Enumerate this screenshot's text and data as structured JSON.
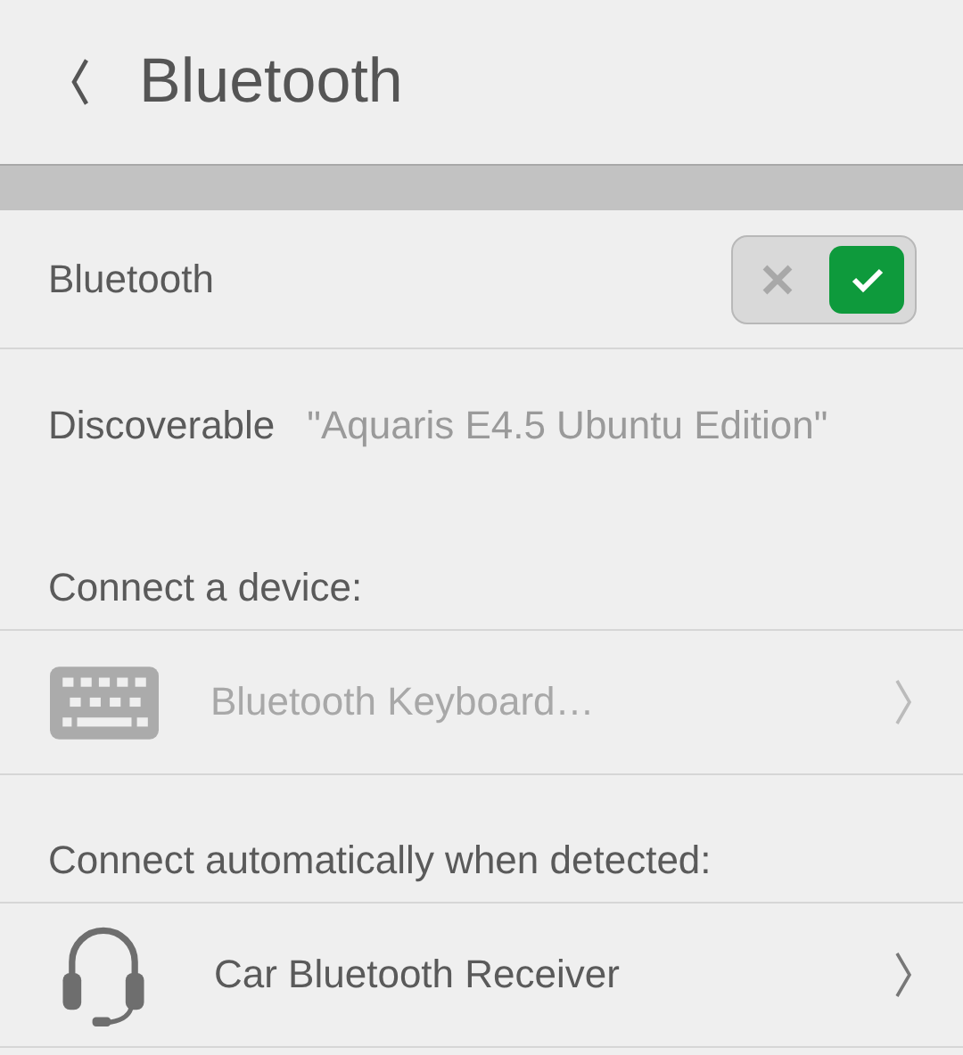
{
  "header": {
    "title": "Bluetooth"
  },
  "toggle_row": {
    "label": "Bluetooth",
    "on": true
  },
  "discoverable": {
    "label": "Discoverable",
    "value": "\"Aquaris E4.5 Ubuntu Edition\""
  },
  "sections": [
    {
      "title": "Connect a device:",
      "devices": [
        {
          "kind": "keyboard",
          "name": "Bluetooth Keyboard…",
          "disabled": true
        }
      ]
    },
    {
      "title": "Connect automatically when detected:",
      "devices": [
        {
          "kind": "headset",
          "name": "Car Bluetooth Receiver",
          "disabled": false
        }
      ]
    }
  ]
}
